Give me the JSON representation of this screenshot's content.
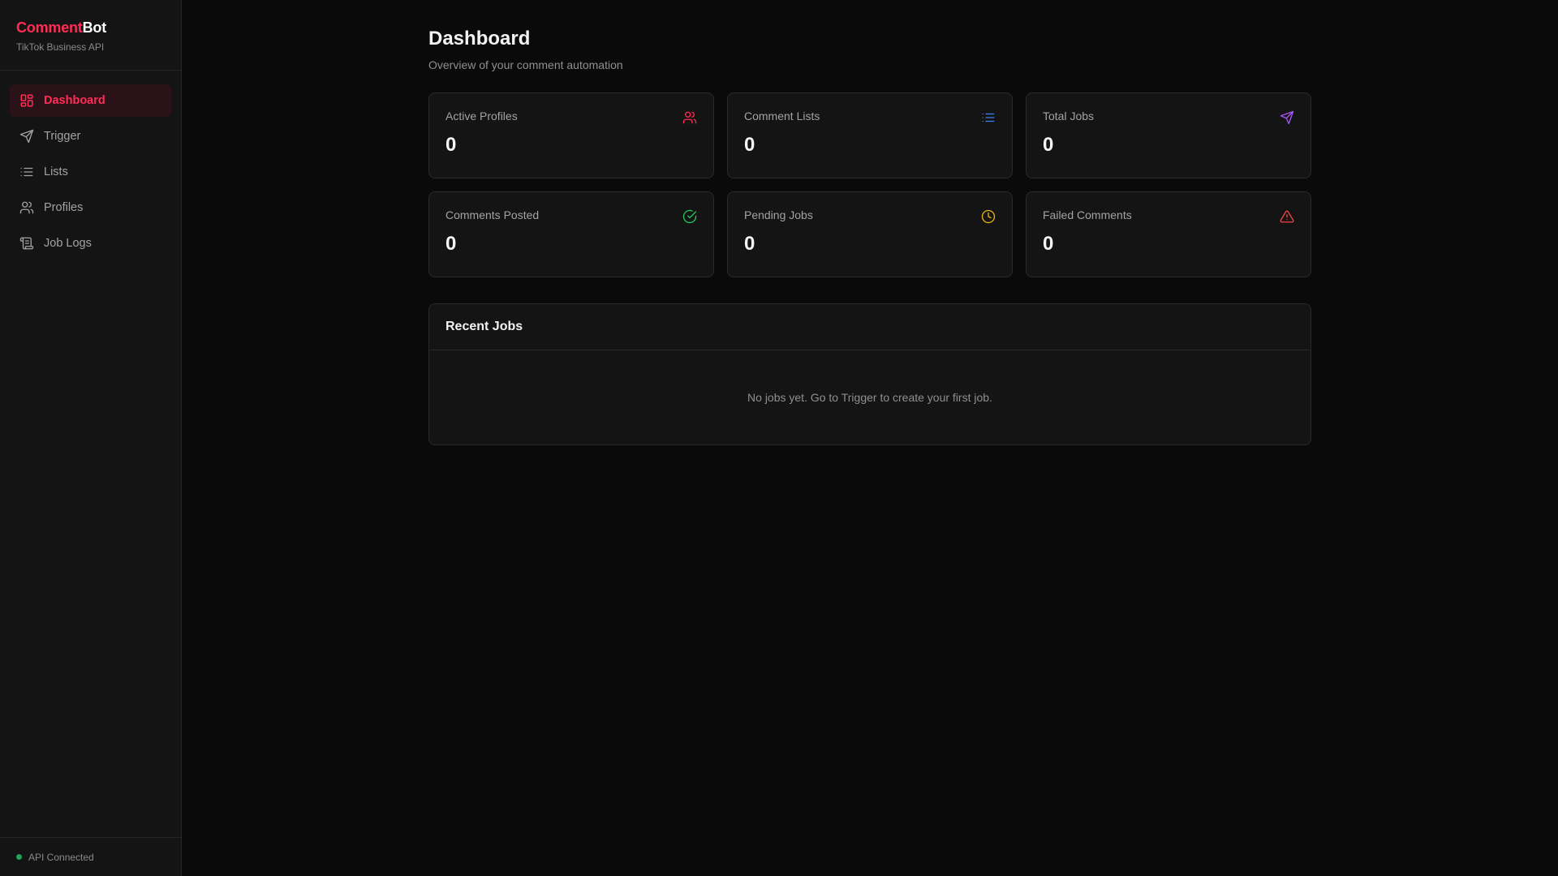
{
  "brand": {
    "accent": "Comment",
    "rest": "Bot",
    "subtitle": "TikTok Business API"
  },
  "nav": [
    {
      "label": "Dashboard",
      "icon": "dashboard-grid-icon",
      "active": true
    },
    {
      "label": "Trigger",
      "icon": "send-icon",
      "active": false
    },
    {
      "label": "Lists",
      "icon": "list-icon",
      "active": false
    },
    {
      "label": "Profiles",
      "icon": "users-icon",
      "active": false
    },
    {
      "label": "Job Logs",
      "icon": "scroll-icon",
      "active": false
    }
  ],
  "status": {
    "label": "API Connected",
    "color": "#22a35a"
  },
  "page": {
    "title": "Dashboard",
    "subtitle": "Overview of your comment automation"
  },
  "stats": [
    {
      "label": "Active Profiles",
      "value": "0",
      "icon": "users-icon",
      "color": "#ff2d55"
    },
    {
      "label": "Comment Lists",
      "value": "0",
      "icon": "list-icon",
      "color": "#3b82f6"
    },
    {
      "label": "Total Jobs",
      "value": "0",
      "icon": "send-icon",
      "color": "#a855f7"
    },
    {
      "label": "Comments Posted",
      "value": "0",
      "icon": "check-circle-icon",
      "color": "#22c55e"
    },
    {
      "label": "Pending Jobs",
      "value": "0",
      "icon": "clock-icon",
      "color": "#eab308"
    },
    {
      "label": "Failed Comments",
      "value": "0",
      "icon": "alert-triangle-icon",
      "color": "#ef4444"
    }
  ],
  "recent_jobs": {
    "title": "Recent Jobs",
    "empty_text": "No jobs yet. Go to Trigger to create your first job."
  },
  "colors": {
    "accent": "#ff2d55",
    "background": "#0a0a0a",
    "surface": "#141414"
  }
}
